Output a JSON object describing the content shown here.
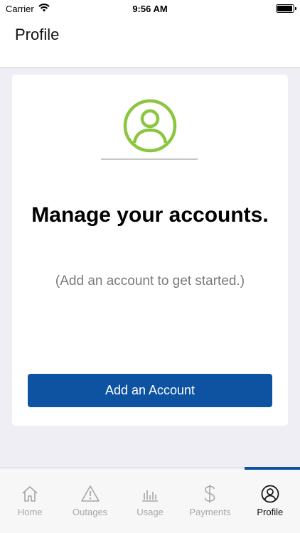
{
  "status_bar": {
    "carrier": "Carrier",
    "time": "9:56 AM",
    "battery_level": 0.95
  },
  "header": {
    "title": "Profile"
  },
  "card": {
    "icon": "user-circle-icon",
    "title": "Manage your accounts.",
    "subtitle": "(Add an account to get started.)",
    "button_label": "Add an Account"
  },
  "tab_bar": {
    "active": "Profile",
    "tabs": [
      {
        "label": "Home",
        "icon": "home-icon"
      },
      {
        "label": "Outages",
        "icon": "warning-icon"
      },
      {
        "label": "Usage",
        "icon": "bar-chart-icon"
      },
      {
        "label": "Payments",
        "icon": "dollar-icon"
      },
      {
        "label": "Profile",
        "icon": "profile-icon"
      }
    ]
  },
  "colors": {
    "accent": "#0d53a1",
    "avatar": "#8cc63f",
    "inactive": "#a6a6a6"
  }
}
